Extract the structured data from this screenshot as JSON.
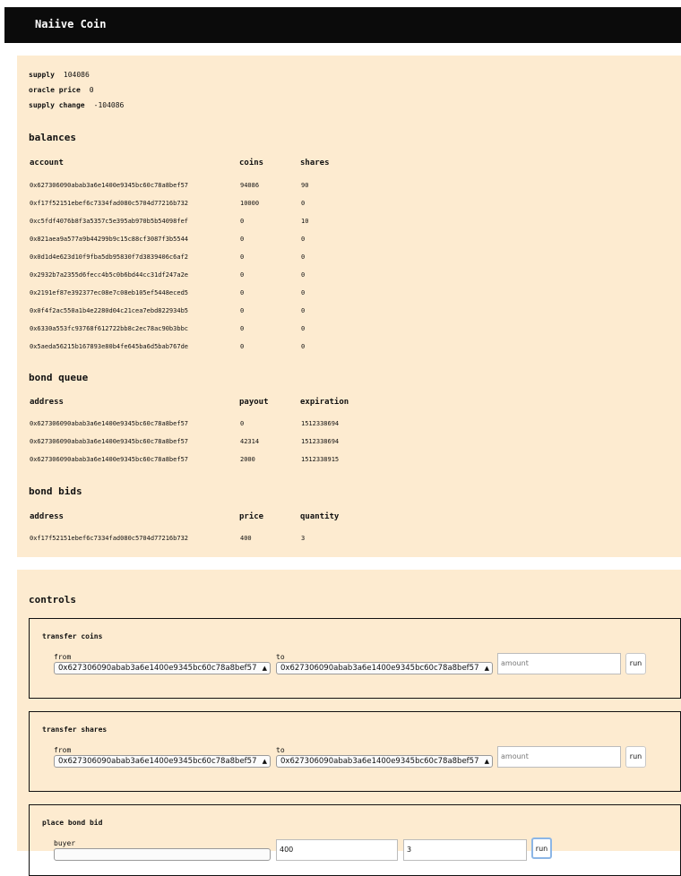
{
  "app": {
    "title": "Naiive Coin"
  },
  "stats": [
    {
      "label": "supply",
      "value": "104086"
    },
    {
      "label": "oracle price",
      "value": "0"
    },
    {
      "label": "supply change",
      "value": "-104086"
    }
  ],
  "balances": {
    "title": "balances",
    "headers": [
      "account",
      "coins",
      "shares"
    ],
    "rows": [
      [
        "0x627306090abab3a6e1400e9345bc60c78a8bef57",
        "94086",
        "90"
      ],
      [
        "0xf17f52151ebef6c7334fad080c5704d77216b732",
        "10000",
        "0"
      ],
      [
        "0xc5fdf4076b8f3a5357c5e395ab970b5b54098fef",
        "0",
        "10"
      ],
      [
        "0x821aea9a577a9b44299b9c15c88cf3087f3b5544",
        "0",
        "0"
      ],
      [
        "0x0d1d4e623d10f9fba5db95830f7d3839406c6af2",
        "0",
        "0"
      ],
      [
        "0x2932b7a2355d6fecc4b5c0b6bd44cc31df247a2e",
        "0",
        "0"
      ],
      [
        "0x2191ef87e392377ec08e7c08eb105ef5448eced5",
        "0",
        "0"
      ],
      [
        "0x0f4f2ac550a1b4e2280d04c21cea7ebd822934b5",
        "0",
        "0"
      ],
      [
        "0x6330a553fc93768f612722bb8c2ec78ac90b3bbc",
        "0",
        "0"
      ],
      [
        "0x5aeda56215b167893e80b4fe645ba6d5bab767de",
        "0",
        "0"
      ]
    ]
  },
  "bond_queue": {
    "title": "bond queue",
    "headers": [
      "address",
      "payout",
      "expiration"
    ],
    "rows": [
      [
        "0x627306090abab3a6e1400e9345bc60c78a8bef57",
        "0",
        "1512338694"
      ],
      [
        "0x627306090abab3a6e1400e9345bc60c78a8bef57",
        "42314",
        "1512338694"
      ],
      [
        "0x627306090abab3a6e1400e9345bc60c78a8bef57",
        "2000",
        "1512338915"
      ]
    ]
  },
  "bond_bids": {
    "title": "bond bids",
    "headers": [
      "address",
      "price",
      "quantity"
    ],
    "rows": [
      [
        "0xf17f52151ebef6c7334fad080c5704d77216b732",
        "400",
        "3"
      ]
    ]
  },
  "controls": {
    "title": "controls",
    "transfer_coins": {
      "title": "transfer coins",
      "from_label": "from",
      "from_value": "0x627306090abab3a6e1400e9345bc60c78a8bef57",
      "to_label": "to",
      "to_value": "0x627306090abab3a6e1400e9345bc60c78a8bef57",
      "amount_placeholder": "amount",
      "run_label": "run"
    },
    "transfer_shares": {
      "title": "transfer shares",
      "from_label": "from",
      "from_value": "0x627306090abab3a6e1400e9345bc60c78a8bef57",
      "to_label": "to",
      "to_value": "0x627306090abab3a6e1400e9345bc60c78a8bef57",
      "amount_placeholder": "amount",
      "run_label": "run"
    },
    "place_bond_bid": {
      "title": "place bond bid",
      "buyer_label": "buyer",
      "price_value": "400",
      "quantity_value": "3",
      "run_label": "run"
    }
  }
}
